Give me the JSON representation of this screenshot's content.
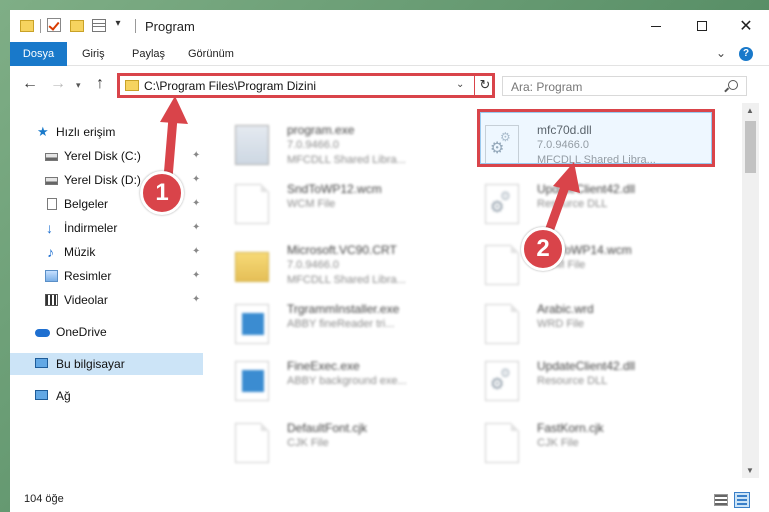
{
  "window": {
    "title": "Program",
    "qa_dropdown": "▾"
  },
  "ribbon": {
    "tabs": [
      "Dosya",
      "Giriş",
      "Paylaş",
      "Görünüm"
    ],
    "expand": "⌄",
    "help": "?"
  },
  "nav": {
    "back": "←",
    "forward": "→",
    "recent": "▾",
    "up": "↑",
    "address": "C:\\Program Files\\Program Dizini",
    "address_dropdown": "⌄",
    "refresh": "↻",
    "search_placeholder": "Ara: Program"
  },
  "sidebar": {
    "items": [
      {
        "label": "Hızlı erişim",
        "icon": "star-icon"
      },
      {
        "label": "Yerel Disk (C:)",
        "icon": "drive-icon",
        "pinned": true
      },
      {
        "label": "Yerel Disk (D:)",
        "icon": "drive-icon",
        "pinned": true
      },
      {
        "label": "Belgeler",
        "icon": "documents-icon",
        "pinned": true
      },
      {
        "label": "İndirmeler",
        "icon": "downloads-icon",
        "pinned": true
      },
      {
        "label": "Müzik",
        "icon": "music-icon",
        "pinned": true
      },
      {
        "label": "Resimler",
        "icon": "pictures-icon",
        "pinned": true
      },
      {
        "label": "Videolar",
        "icon": "videos-icon",
        "pinned": true
      },
      {
        "label": "OneDrive",
        "icon": "cloud-icon"
      },
      {
        "label": "Bu bilgisayar",
        "icon": "computer-icon",
        "selected": true
      },
      {
        "label": "Ağ",
        "icon": "network-icon"
      }
    ],
    "pin_glyph": "📌"
  },
  "files": [
    {
      "name": "program.exe",
      "line2": "7.0.9466.0",
      "line3": "MFCDLL Shared Libra...",
      "icon": "exe-icon",
      "blurred": true
    },
    {
      "name": "mfc70d.dll",
      "line2": "7.0.9466.0",
      "line3": "MFCDLL Shared Libra...",
      "icon": "dll-icon",
      "blurred": false,
      "highlighted": true
    },
    {
      "name": "SndToWP12.wcm",
      "line2": "WCM File",
      "line3": "",
      "icon": "file-icon",
      "blurred": true
    },
    {
      "name": "UpdateClient42.dll",
      "line2": "Resource DLL",
      "line3": "",
      "icon": "dll-icon",
      "blurred": true
    },
    {
      "name": "Microsoft.VC90.CRT",
      "line2": "7.0.9466.0",
      "line3": "MFCDLL Shared Libra...",
      "icon": "folder-icon",
      "blurred": true
    },
    {
      "name": "SndToWP14.wcm",
      "line2": "WCM File",
      "line3": "",
      "icon": "file-icon",
      "blurred": true
    },
    {
      "name": "TrgrammInstaller.exe",
      "line2": "ABBY fineReader tri...",
      "line3": "",
      "icon": "app-icon",
      "blurred": true
    },
    {
      "name": "Arabic.wrd",
      "line2": "WRD File",
      "line3": "",
      "icon": "file-icon",
      "blurred": true
    },
    {
      "name": "FineExec.exe",
      "line2": "ABBY background exe...",
      "line3": "",
      "icon": "app-icon",
      "blurred": true
    },
    {
      "name": "UpdateClient42.dll",
      "line2": "Resource DLL",
      "line3": "",
      "icon": "dll-icon",
      "blurred": true
    },
    {
      "name": "DefaultFont.cjk",
      "line2": "CJK File",
      "line3": "",
      "icon": "file-icon",
      "blurred": true
    },
    {
      "name": "FastKorn.cjk",
      "line2": "CJK File",
      "line3": "",
      "icon": "file-icon",
      "blurred": true
    }
  ],
  "status": {
    "count": "104 öğe"
  },
  "callouts": {
    "step1": "1",
    "step2": "2"
  },
  "colors": {
    "accent": "#1979ca",
    "highlight_red": "#d9444a",
    "selection": "#cce4f7"
  }
}
